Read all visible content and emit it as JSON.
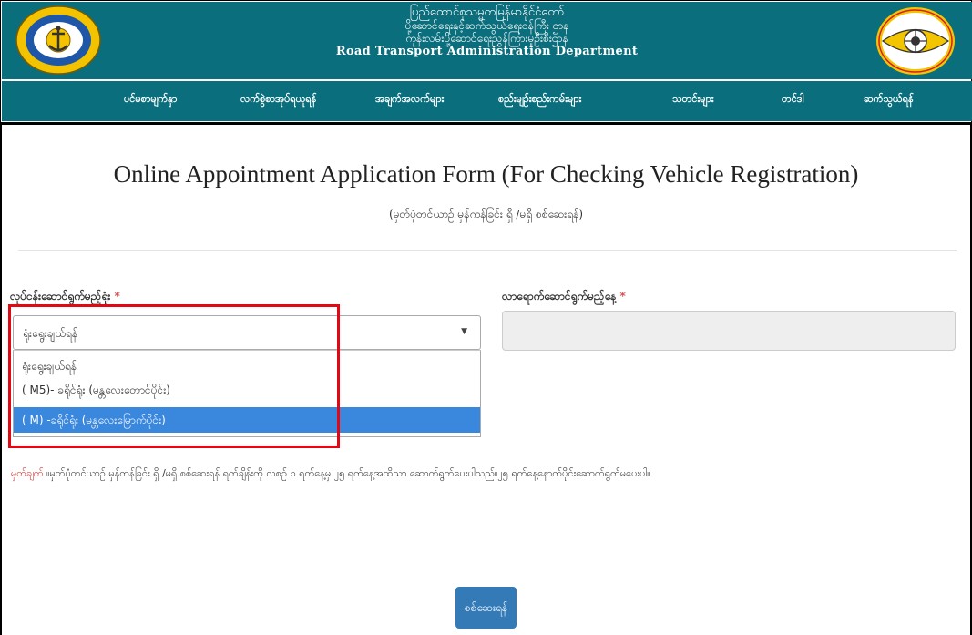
{
  "header": {
    "title_line1": "ပြည်ထောင်စုသမ္မတမြန်မာနိုင်ငံတော်",
    "title_line2": "ပို့ဆောင်ရေးနှင့်ဆက်သွယ်ရေးဝန်ကြီး ဌာန",
    "title_line3": "ကုန်းလမ်းပို့ဆောင်ရေးညွှန်ကြားမှုဦးစီးဌာန",
    "title_line4": "Road Transport Administration Department",
    "left_logo_icon": "ministry-seal-icon",
    "right_logo_icon": "rtad-wheel-logo-icon",
    "bg_color": "#0b6e7c"
  },
  "nav": {
    "items": [
      "ပင်မစာမျက်နှာ",
      "လက်စွဲစာအုပ်ရယူရန်",
      "အချက်အလက်များ",
      "စည်းမျဉ်းစည်းကမ်းများ",
      "သတင်းများ",
      "တင်ဒါ",
      "ဆက်သွယ်ရန်"
    ]
  },
  "form": {
    "title": "Online Appointment Application Form (For Checking Vehicle Registration)",
    "subtitle": "(မှတ်ပုံတင်ယာဉ် မှန်ကန်ခြင်း ရှိ /မရှိ စစ်ဆေးရန်)",
    "office_label": "လုပ်ငန်းဆောင်ရွက်မည့်ရုံး",
    "date_label": "လာရောက်ဆောင်ရွက်မည့်နေ့",
    "required_mark": "*",
    "office_select": {
      "selected": "ရုံးရွေးချယ်ရန်",
      "options": [
        "ရုံးရွေးချယ်ရန်",
        "( M5)- ခရိုင်ရုံး (မန္တလေးတောင်ပိုင်း)",
        "( M) -ခရိုင်ရုံး (မန္တလေးမြောက်ပိုင်း)"
      ],
      "highlighted_index": 2
    },
    "date_value": "",
    "note_head": "မှတ်ချက်",
    "note_body": " ။မှတ်ပုံတင်ယာဉ် မှန်ကန်ခြင်း ရှိ /မရှိ စစ်ဆေးရန် ရက်ချိန်းကို လစဉ် ၁ ရက်နေ့မှ ၂၅ ရက်နေ့အထိသာ ဆောက်ရွက်ပေးပါသည်။၂၅ ရက်နေ့နောက်ပိုင်းဆောက်ရွက်မပေးပါ။",
    "submit_label": "စစ်ဆေးရန်"
  },
  "colors": {
    "accent": "#337ab7",
    "highlight": "#3a87de",
    "required": "#d9534f",
    "annotation_box": "#e30613"
  }
}
